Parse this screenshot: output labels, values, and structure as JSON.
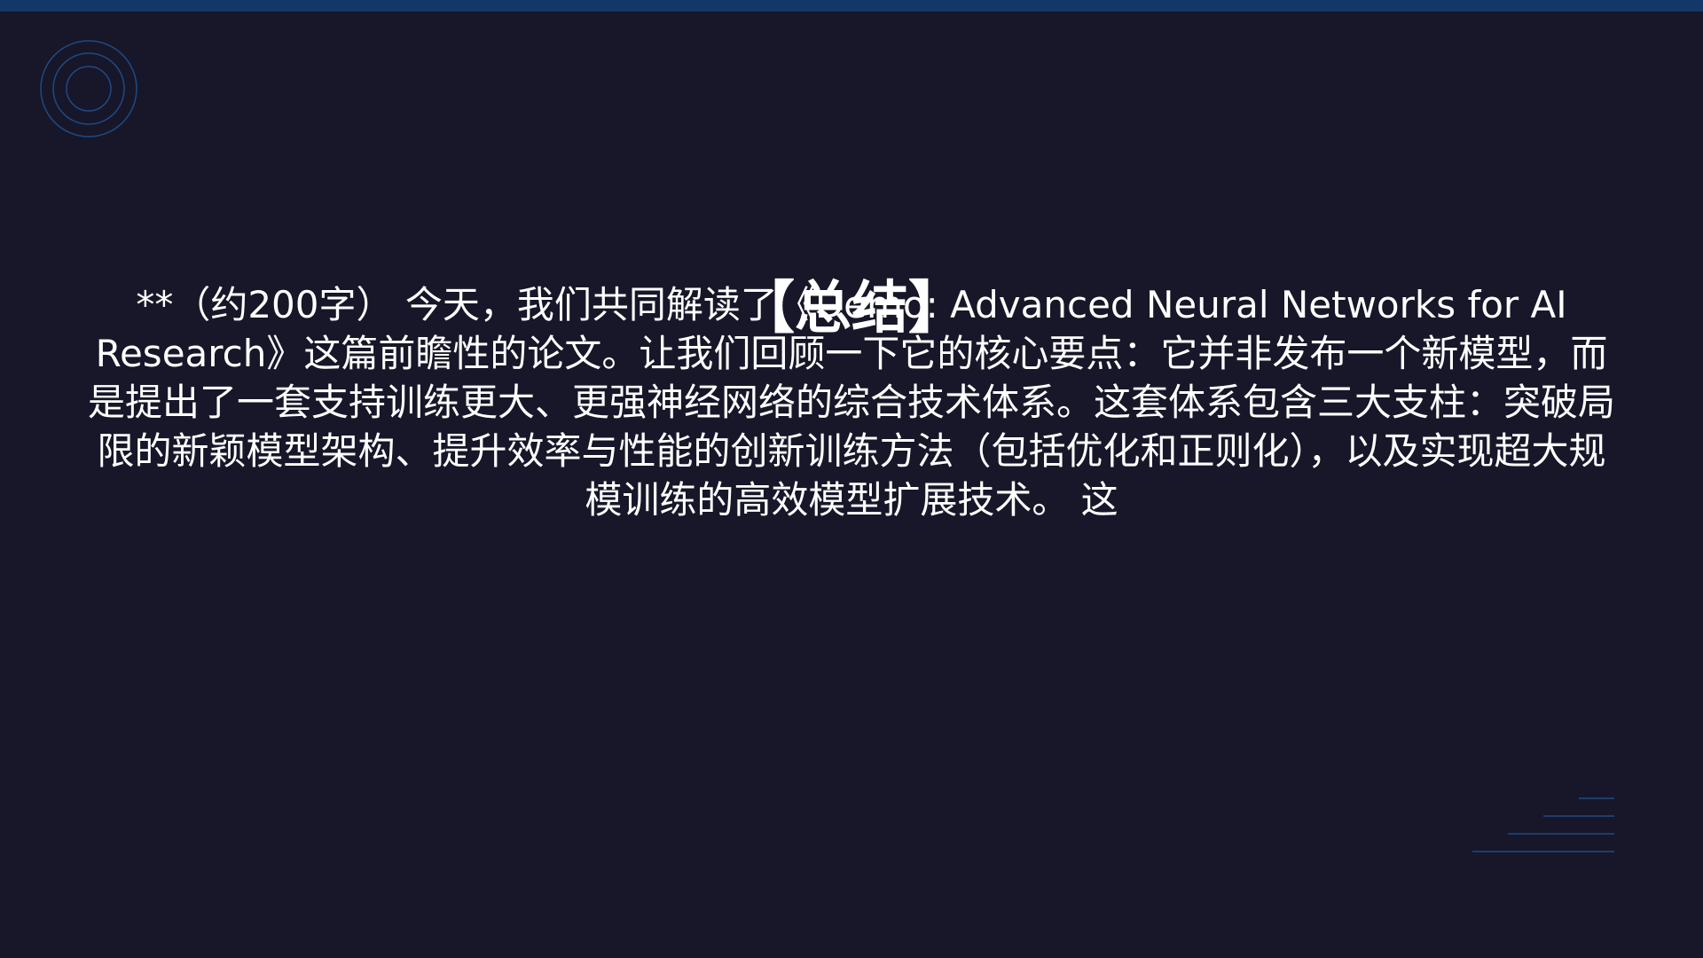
{
  "slide": {
    "title": "【总结】",
    "body": "**（约200字） 今天，我们共同解读了《Demo: Advanced Neural Networks for AI Research》这篇前瞻性的论文。让我们回顾一下它的核心要点：它并非发布一个新模型，而是提出了一套支持训练更大、更强神经网络的综合技术体系。这套体系包含三大支柱：突破局限的新颖模型架构、提升效率与性能的创新训练方法（包括优化和正则化），以及实现超大规模训练的高效模型扩展技术。 这"
  },
  "theme": {
    "background": "#171729",
    "top_bar": "#133766",
    "accent": "#1e4a86",
    "text": "#ffffff"
  },
  "icons": {
    "top_left": "concentric-circles-icon",
    "bottom_right": "stacked-lines-icon"
  }
}
